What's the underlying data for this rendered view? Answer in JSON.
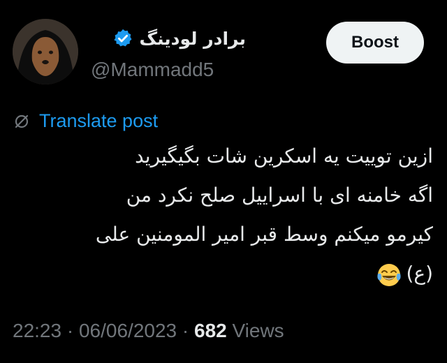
{
  "author": {
    "display_name": "برادر لودینگ",
    "handle": "@Mammadd5",
    "verified": true,
    "verified_color": "#1d9bf0"
  },
  "actions": {
    "boost_label": "Boost"
  },
  "translate": {
    "label": "Translate post",
    "icon": "translate-slash-icon"
  },
  "post": {
    "lines": [
      "ازین توییت یه اسکرین شات بگیگیرید",
      "اگه خامنه ای با اسراییل صلح نکرد من",
      "کیرمو میکنم وسط قبر امیر المومنین علی",
      "(ع)"
    ],
    "emoji": "face-with-tears-of-joy-icon"
  },
  "meta": {
    "time": "22:23",
    "separator": " · ",
    "date": "06/06/2023",
    "views_count": "682",
    "views_label": "Views"
  },
  "colors": {
    "background": "#000000",
    "text": "#e7e9ea",
    "secondary": "#71767b",
    "link": "#1d9bf0",
    "button_bg": "#eff3f4"
  }
}
